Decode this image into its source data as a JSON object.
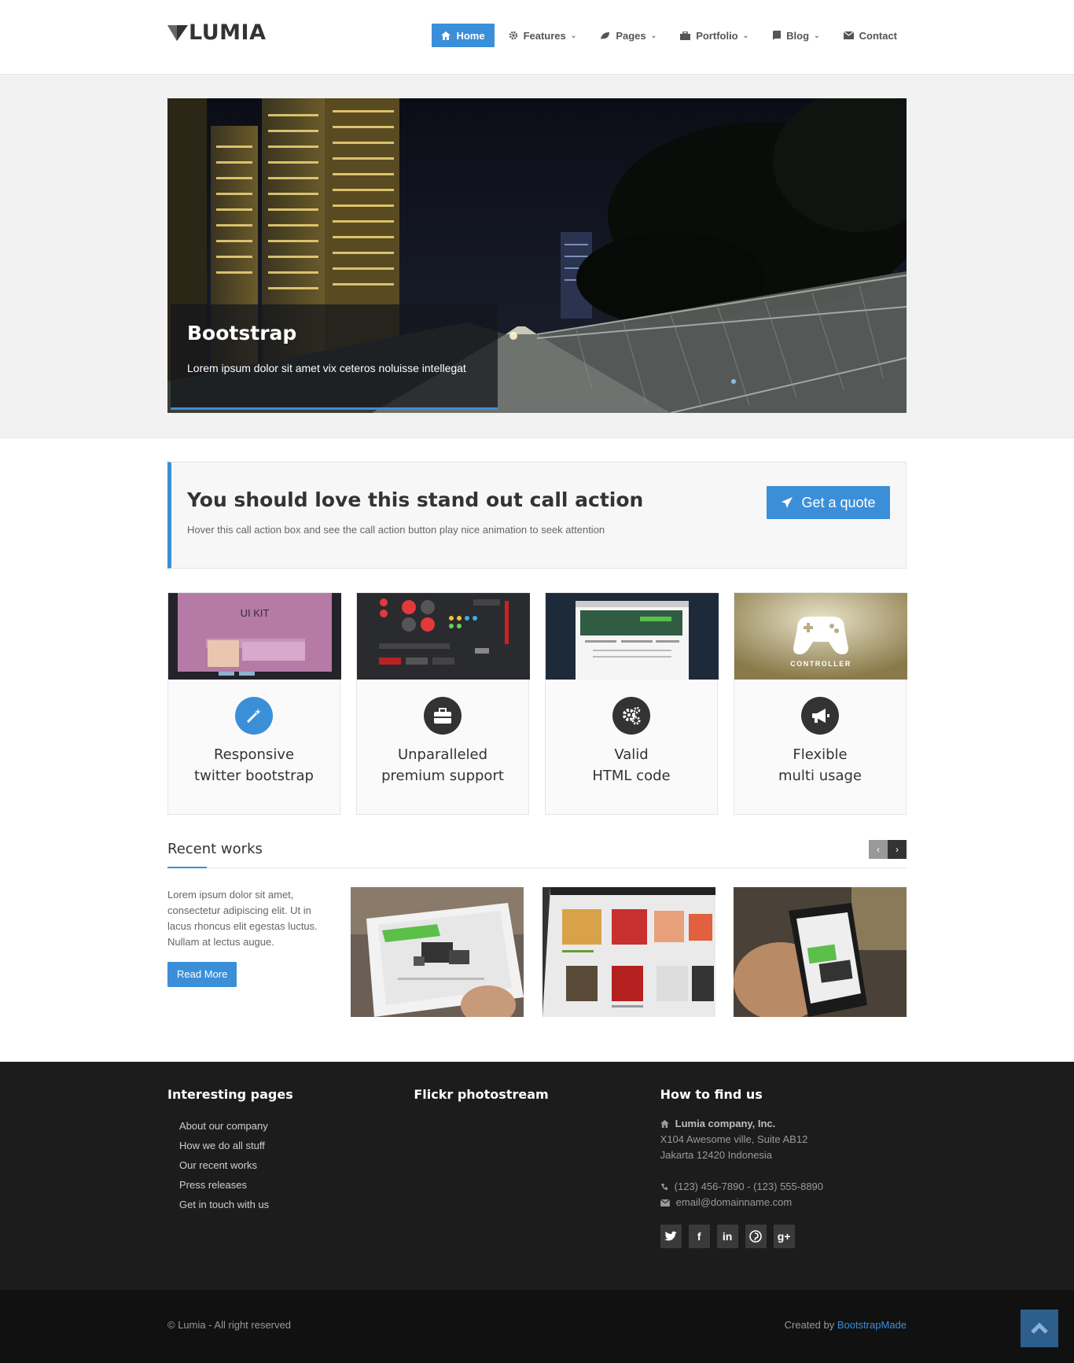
{
  "brand": {
    "name": "LUMIA"
  },
  "nav": [
    {
      "label": "Home",
      "icon": "home-icon",
      "active": true
    },
    {
      "label": "Features",
      "icon": "gear-icon",
      "dropdown": true
    },
    {
      "label": "Pages",
      "icon": "leaf-icon",
      "dropdown": true
    },
    {
      "label": "Portfolio",
      "icon": "briefcase-icon",
      "dropdown": true
    },
    {
      "label": "Blog",
      "icon": "book-icon",
      "dropdown": true
    },
    {
      "label": "Contact",
      "icon": "envelope-icon"
    }
  ],
  "slider": {
    "title": "Bootstrap",
    "text": "Lorem ipsum dolor sit amet vix ceteros noluisse intellegat"
  },
  "cta": {
    "title": "You should love this stand out call action",
    "subtitle": "Hover this call action box and see the call action button play nice animation to seek attention",
    "button": "Get a quote"
  },
  "features": [
    {
      "title_line1": "Responsive",
      "title_line2": "twitter bootstrap",
      "icon": "magic-wand-icon",
      "icon_color": "#3b8fd9",
      "thumb_text": "UI KIT"
    },
    {
      "title_line1": "Unparalleled",
      "title_line2": "premium support",
      "icon": "briefcase-icon",
      "icon_color": "#333333"
    },
    {
      "title_line1": "Valid",
      "title_line2": "HTML code",
      "icon": "cogs-icon",
      "icon_color": "#333333"
    },
    {
      "title_line1": "Flexible",
      "title_line2": "multi usage",
      "icon": "bullhorn-icon",
      "icon_color": "#333333",
      "thumb_text": "CONTROLLER"
    }
  ],
  "recent": {
    "title": "Recent works",
    "text": "Lorem ipsum dolor sit amet, consectetur adipiscing elit. Ut in lacus rhoncus elit egestas luctus. Nullam at lectus augue.",
    "button": "Read More",
    "prev": "‹",
    "next": "›"
  },
  "footer": {
    "col1": {
      "title": "Interesting pages",
      "links": [
        "About our company",
        "How we do all stuff",
        "Our recent works",
        "Press releases",
        "Get in touch with us"
      ]
    },
    "col2": {
      "title": "Flickr photostream"
    },
    "col3": {
      "title": "How to find us",
      "company": "Lumia company, Inc.",
      "address1": "X104 Awesome ville, Suite AB12",
      "address2": "Jakarta 12420 Indonesia",
      "phone": "(123) 456-7890 - (123) 555-8890",
      "email": "email@domainname.com",
      "social": [
        "twitter-icon",
        "facebook-icon",
        "linkedin-icon",
        "pinterest-icon",
        "google-plus-icon"
      ]
    }
  },
  "subfooter": {
    "copyright": "© Lumia - All right reserved",
    "credit_prefix": "Created by ",
    "credit_link": "BootstrapMade"
  },
  "colors": {
    "accent": "#3b8fd9",
    "footer_bg": "#1c1c1c",
    "subfooter_bg": "#111111"
  }
}
